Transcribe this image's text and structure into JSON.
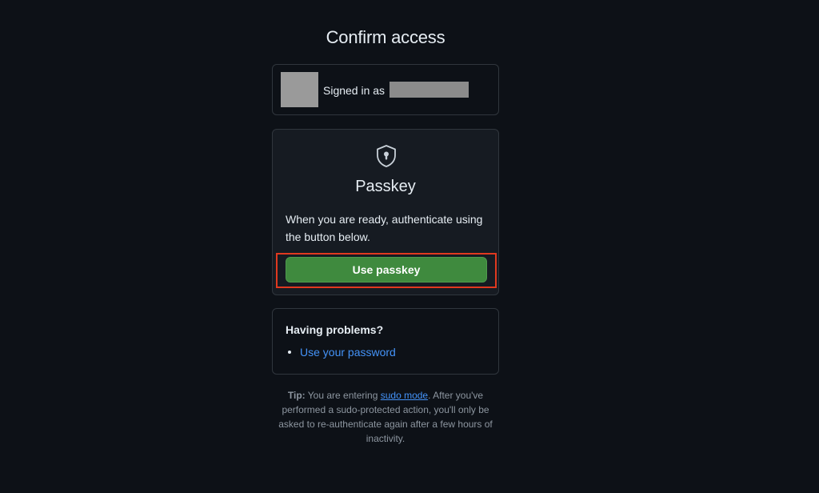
{
  "page": {
    "title": "Confirm access"
  },
  "account": {
    "signed_in_label": "Signed in as"
  },
  "passkey": {
    "icon": "shield-lock-icon",
    "title": "Passkey",
    "description": "When you are ready, authenticate using the button below.",
    "button_label": "Use passkey",
    "button_color": "#3f8a3e",
    "highlight_color": "#e0391f"
  },
  "problems": {
    "title": "Having problems?",
    "items": [
      {
        "label": "Use your password"
      }
    ]
  },
  "tip": {
    "prefix": "Tip:",
    "text_before": " You are entering ",
    "link_label": "sudo mode",
    "text_after": ". After you've performed a sudo-protected action, you'll only be asked to re-authenticate again after a few hours of inactivity."
  }
}
